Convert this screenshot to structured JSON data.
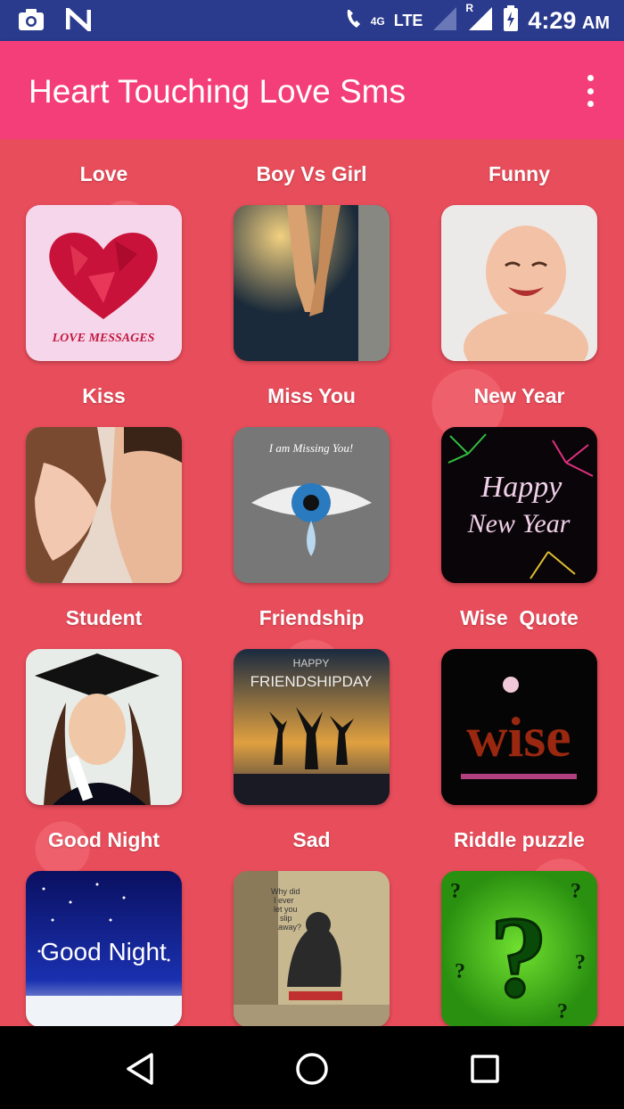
{
  "status_bar": {
    "time": "4:29",
    "ampm": "AM",
    "network_label": "4G",
    "lte_label": "LTE",
    "roaming_label": "R",
    "icons": [
      "camera-icon",
      "notification-n-icon",
      "wifi-call-icon",
      "signal-icon",
      "battery-charging-icon"
    ]
  },
  "app_bar": {
    "title": "Heart Touching Love Sms",
    "menu_icon": "overflow-menu-icon"
  },
  "categories": [
    {
      "label": "Love",
      "image": "love-messages-heart"
    },
    {
      "label": "Boy Vs Girl",
      "image": "holding-hands"
    },
    {
      "label": "Funny",
      "image": "laughing-baby"
    },
    {
      "label": "Kiss",
      "image": "couple-kiss"
    },
    {
      "label": "Miss You",
      "image": "crying-eye"
    },
    {
      "label": "New Year",
      "image": "happy-new-year-fireworks"
    },
    {
      "label": "Student",
      "image": "graduate-student"
    },
    {
      "label": "Friendship",
      "image": "friendship-day-silhouettes"
    },
    {
      "label": "Wise  Quote",
      "image": "wise-text"
    },
    {
      "label": "Good Night",
      "image": "good-night-moon"
    },
    {
      "label": "Sad",
      "image": "sad-person"
    },
    {
      "label": "Riddle puzzle",
      "image": "question-marks"
    }
  ],
  "image_texts": {
    "love": "LOVE MESSAGES",
    "missyou": "I am Missing You!",
    "newyear_1": "Happy",
    "newyear_2": "New Year",
    "friendship_1": "HAPPY",
    "friendship_2": "FRIENDSHIPDAY",
    "wise": "wise",
    "goodnight": "Good Night",
    "sad_1": "Why did",
    "sad_2": "I ever",
    "sad_3": "let you",
    "sad_4": "slip",
    "sad_5": "away?"
  },
  "nav_bar": {
    "back": "back-icon",
    "home": "home-icon",
    "recents": "recents-icon"
  },
  "colors": {
    "status_bar": "#2a3a8c",
    "app_bar": "#f43e7a",
    "background": "#e84d5b",
    "nav_bar": "#000000"
  }
}
